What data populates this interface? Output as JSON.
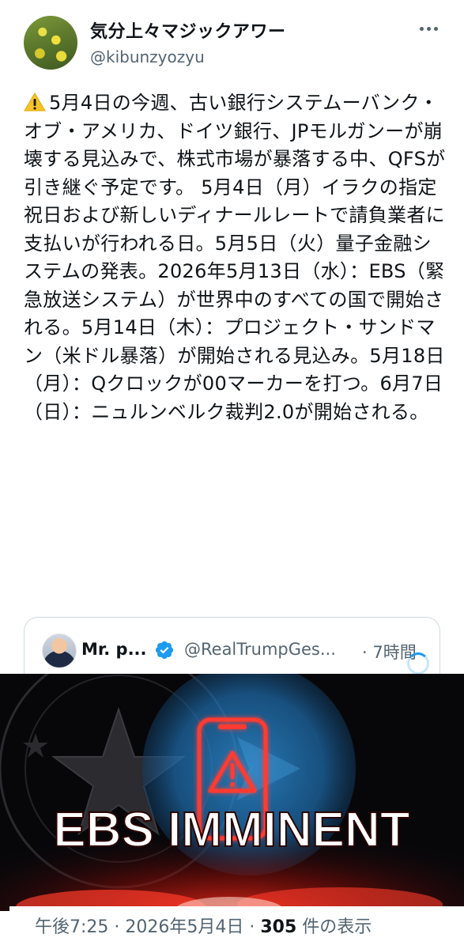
{
  "author": {
    "display_name": "気分上々マジックアワー",
    "handle": "@kibunzyozyu"
  },
  "icons": {
    "avatar": "rapeseed-flower-photo",
    "more": "more-horizontal-icon",
    "warning": "warning-sign-icon",
    "verified": "verified-badge-icon",
    "media_phone": "phone-alert-icon"
  },
  "tweet": {
    "text": "5月4日の今週、古い銀行システムーバンク・オブ・アメリカ、ドイツ銀行、JPモルガンーが崩壊する見込みで、株式市場が暴落する中、QFSが引き継ぐ予定です。 5月4日（月）イラクの指定祝日および新しいディナールレートで請負業者に支払いが行われる日。5月5日（火）量子金融システムの発表。2026年5月13日（水）：EBS（緊急放送システム）が世界中のすべての国で開始される。5月14日（木）：プロジェクト・サンドマン（米ドル暴落）が開始される見込み。5月18日（月）：Qクロックが00マーカーを打つ。6月7日（日）：ニュルンベルク裁判2.0が開始される。"
  },
  "quoted": {
    "name": "Mr. p...",
    "handle": "@RealTrumpGes...",
    "separator": "·",
    "time": "7時間"
  },
  "media": {
    "caption": "EBS IMMINENT"
  },
  "footer": {
    "time": "午後7:25",
    "sep1": " · ",
    "date": "2026年5月4日",
    "sep2": " · ",
    "views_count": "305",
    "views_label": " 件の表示"
  },
  "colors": {
    "text_primary": "#0f1419",
    "text_secondary": "#536471",
    "verified_blue": "#1d9bf0",
    "alert_red": "#ff3b30",
    "border": "#cfd9de"
  }
}
